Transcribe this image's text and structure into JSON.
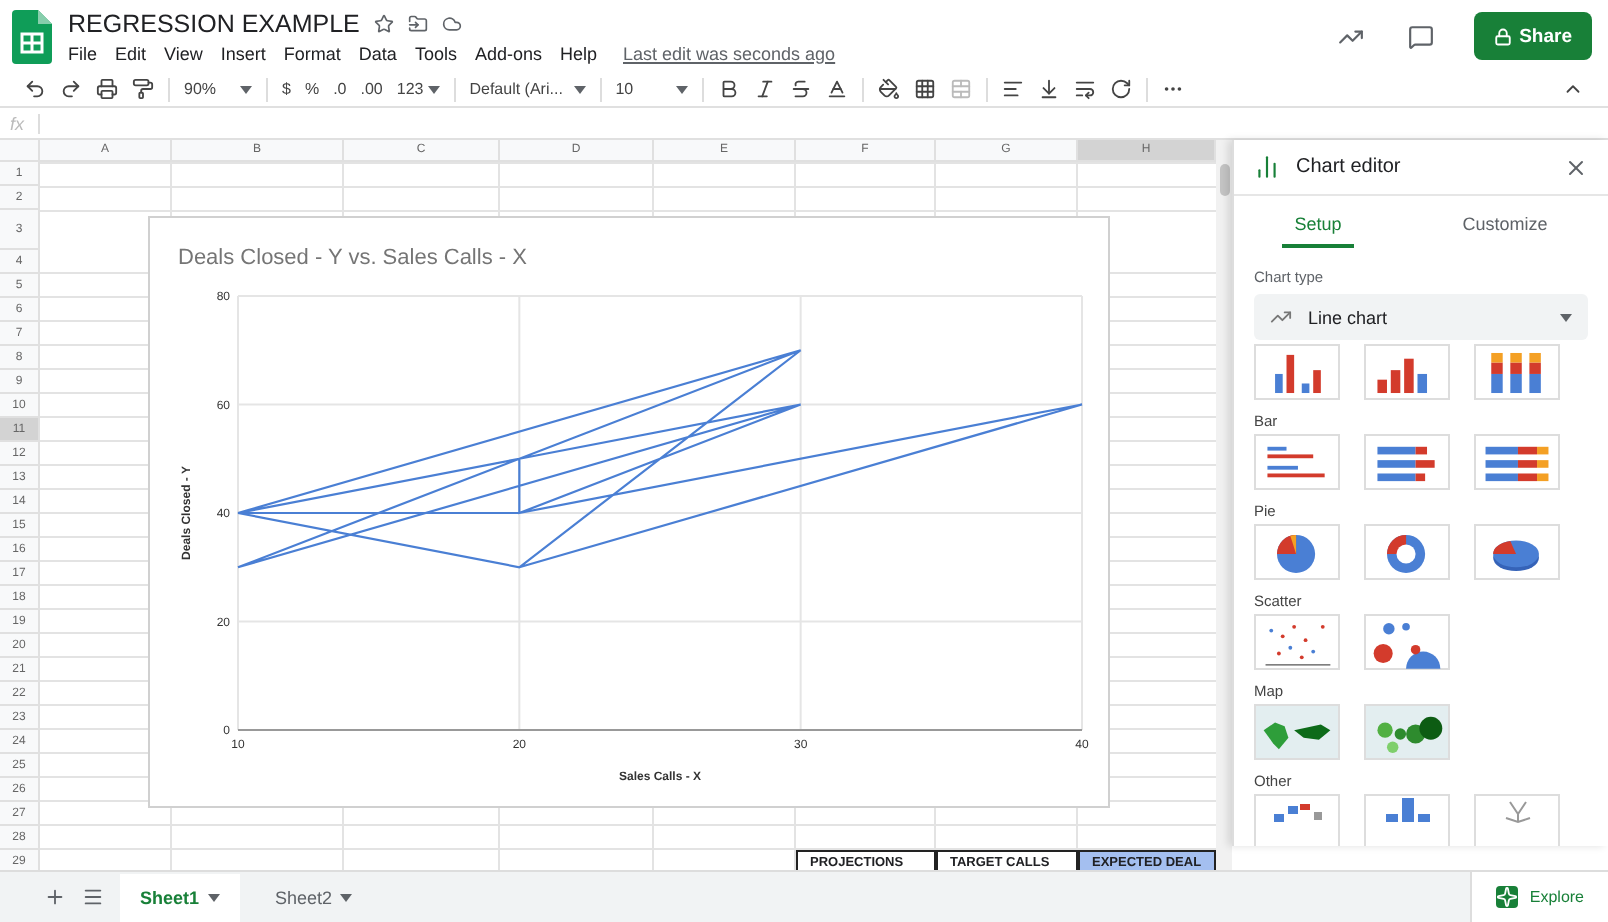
{
  "document": {
    "title": "REGRESSION EXAMPLE",
    "last_edit": "Last edit was seconds ago"
  },
  "menu": [
    "File",
    "Edit",
    "View",
    "Insert",
    "Format",
    "Data",
    "Tools",
    "Add-ons",
    "Help"
  ],
  "share": "Share",
  "toolbar": {
    "zoom": "90%",
    "currency": "$",
    "percent": "%",
    "decrease_decimals": ".0",
    "increase_decimals": ".00",
    "more_formats": "123",
    "font": "Default (Ari...",
    "font_size": "10"
  },
  "formula_label": "fx",
  "sheet": {
    "columns": [
      {
        "label": "A",
        "selected": false
      },
      {
        "label": "B",
        "selected": false
      },
      {
        "label": "C",
        "selected": false
      },
      {
        "label": "D",
        "selected": false
      },
      {
        "label": "E",
        "selected": false
      },
      {
        "label": "F",
        "selected": false
      },
      {
        "label": "G",
        "selected": false
      },
      {
        "label": "H",
        "selected": true
      }
    ],
    "rows": [
      {
        "label": "1",
        "selected": false
      },
      {
        "label": "2",
        "selected": false
      },
      {
        "label": "3",
        "selected": false
      },
      {
        "label": "4",
        "selected": false
      },
      {
        "label": "5",
        "selected": false
      },
      {
        "label": "6",
        "selected": false
      },
      {
        "label": "7",
        "selected": false
      },
      {
        "label": "8",
        "selected": false
      },
      {
        "label": "9",
        "selected": false
      },
      {
        "label": "10",
        "selected": false
      },
      {
        "label": "11",
        "selected": true
      },
      {
        "label": "12",
        "selected": false
      },
      {
        "label": "13",
        "selected": false
      },
      {
        "label": "14",
        "selected": false
      },
      {
        "label": "15",
        "selected": false
      },
      {
        "label": "16",
        "selected": false
      },
      {
        "label": "17",
        "selected": false
      },
      {
        "label": "18",
        "selected": false
      },
      {
        "label": "19",
        "selected": false
      },
      {
        "label": "20",
        "selected": false
      },
      {
        "label": "21",
        "selected": false
      },
      {
        "label": "22",
        "selected": false
      },
      {
        "label": "23",
        "selected": false
      },
      {
        "label": "24",
        "selected": false
      },
      {
        "label": "25",
        "selected": false
      },
      {
        "label": "26",
        "selected": false
      },
      {
        "label": "27",
        "selected": false
      },
      {
        "label": "28",
        "selected": false
      },
      {
        "label": "29",
        "selected": false
      }
    ],
    "last_row_cells": [
      {
        "text": "PROJECTIONS",
        "selected": false
      },
      {
        "text": "TARGET CALLS",
        "selected": false
      },
      {
        "text": "EXPECTED DEAL",
        "selected": true
      }
    ]
  },
  "chart": {
    "chart_data": {
      "type": "line",
      "title": "Deals Closed - Y vs. Sales Calls - X",
      "xlabel": "Sales Calls - X",
      "ylabel": "Deals Closed - Y",
      "x": [
        10,
        30,
        10,
        30,
        20,
        10,
        20,
        30,
        20,
        40,
        20,
        20,
        10,
        20,
        30,
        10
      ],
      "grid": true,
      "series": [
        {
          "color": "#4a7fd4",
          "values": [
            40,
            70,
            30,
            60,
            40,
            40,
            30,
            70,
            30,
            60,
            40,
            50,
            40,
            50,
            60,
            30
          ]
        }
      ],
      "xlim": [
        10,
        40
      ],
      "ylim": [
        0,
        80
      ],
      "xticks": [
        10,
        20,
        30,
        40
      ],
      "yticks": [
        0,
        20,
        40,
        60,
        80
      ]
    }
  },
  "editor": {
    "title": "Chart editor",
    "tabs": [
      {
        "label": "Setup",
        "selected": true
      },
      {
        "label": "Customize",
        "selected": false
      }
    ],
    "chart_type_label": "Chart type",
    "chart_type": "Line chart",
    "sections": [
      {
        "options": [
          {
            "kind": "column"
          },
          {
            "kind": "column-grouped"
          },
          {
            "kind": "column-stacked"
          }
        ]
      },
      {
        "heading": "Bar",
        "options": [
          {
            "kind": "bar"
          },
          {
            "kind": "bar-stacked"
          },
          {
            "kind": "bar-stacked-full"
          }
        ]
      },
      {
        "heading": "Pie",
        "options": [
          {
            "kind": "pie"
          },
          {
            "kind": "donut"
          },
          {
            "kind": "pie-3d"
          }
        ]
      },
      {
        "heading": "Scatter",
        "options": [
          {
            "kind": "scatter"
          },
          {
            "kind": "bubble"
          }
        ]
      },
      {
        "heading": "Map",
        "options": [
          {
            "kind": "geo"
          },
          {
            "kind": "geo-markers"
          }
        ]
      },
      {
        "heading": "Other",
        "options": [
          {
            "kind": "timeline"
          },
          {
            "kind": "histogram"
          },
          {
            "kind": "org"
          }
        ]
      }
    ]
  },
  "sheet_tabs": [
    {
      "label": "Sheet1",
      "selected": true
    },
    {
      "label": "Sheet2",
      "selected": false
    }
  ],
  "explore": "Explore"
}
